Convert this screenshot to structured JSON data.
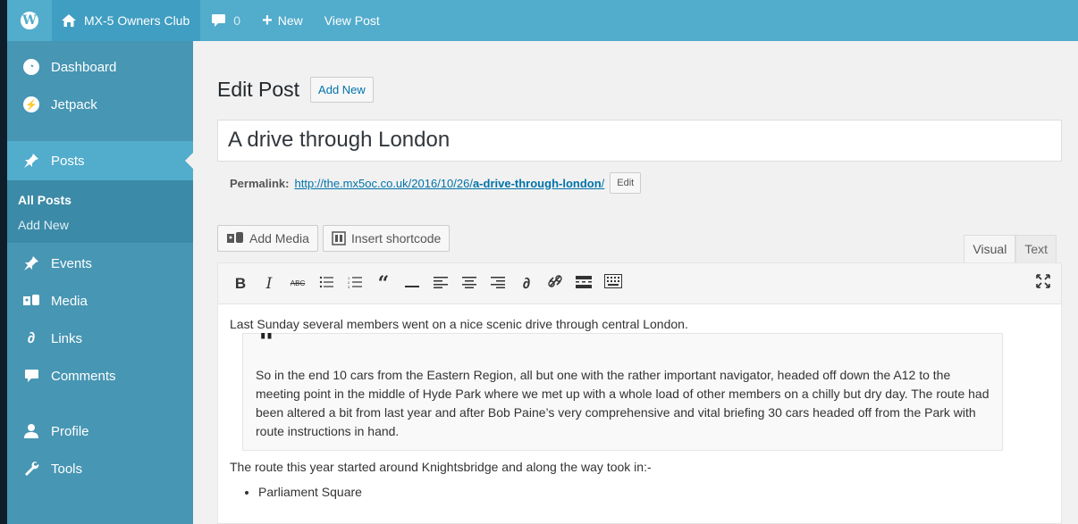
{
  "adminbar": {
    "wp_icon": "wordpress-icon",
    "site_name": "MX-5 Owners Club",
    "comments_count": "0",
    "new_label": "New",
    "view_post_label": "View Post"
  },
  "sidebar": {
    "items": [
      {
        "label": "Dashboard",
        "icon": "dashboard-icon"
      },
      {
        "label": "Jetpack",
        "icon": "jetpack-icon"
      },
      {
        "label": "Posts",
        "icon": "pin-icon"
      },
      {
        "label": "Events",
        "icon": "pin-icon"
      },
      {
        "label": "Media",
        "icon": "media-icon"
      },
      {
        "label": "Links",
        "icon": "link-icon"
      },
      {
        "label": "Comments",
        "icon": "comment-icon"
      },
      {
        "label": "Profile",
        "icon": "user-icon"
      },
      {
        "label": "Tools",
        "icon": "wrench-icon"
      }
    ],
    "submenu": [
      {
        "label": "All Posts"
      },
      {
        "label": "Add New"
      }
    ]
  },
  "page": {
    "title": "Edit Post",
    "add_new": "Add New"
  },
  "post": {
    "title": "A drive through London",
    "permalink_label": "Permalink:",
    "permalink_base": "http://the.mx5oc.co.uk/2016/10/26/",
    "permalink_slug": "a-drive-through-london",
    "permalink_end": "/",
    "edit_label": "Edit"
  },
  "editor": {
    "add_media": "Add Media",
    "insert_shortcode": "Insert shortcode",
    "tab_visual": "Visual",
    "tab_text": "Text",
    "toolbar": [
      {
        "name": "bold-icon",
        "glyph": "B"
      },
      {
        "name": "italic-icon",
        "glyph": "I"
      },
      {
        "name": "strikethrough-icon",
        "glyph": "ABC"
      },
      {
        "name": "bullet-list-icon",
        "glyph": "☰"
      },
      {
        "name": "numbered-list-icon",
        "glyph": "☷"
      },
      {
        "name": "blockquote-icon",
        "glyph": "❝"
      },
      {
        "name": "horizontal-line-icon",
        "glyph": "—"
      },
      {
        "name": "align-left-icon",
        "glyph": "☰"
      },
      {
        "name": "align-center-icon",
        "glyph": "☰"
      },
      {
        "name": "align-right-icon",
        "glyph": "☰"
      },
      {
        "name": "link-icon",
        "glyph": "🔗"
      },
      {
        "name": "unlink-icon",
        "glyph": "⛓"
      },
      {
        "name": "read-more-icon",
        "glyph": "▬"
      },
      {
        "name": "toolbar-toggle-icon",
        "glyph": "▦"
      }
    ],
    "paragraph1": "Last Sunday several members went on a nice scenic drive through central London.",
    "quote": "So in the end 10 cars from the Eastern Region, all but one with the rather important navigator, headed off down the A12 to the meeting point in the middle of Hyde Park where we met up with a whole load of other members on a chilly but dry day.  The route had been altered a bit from last year and after Bob Paine’s very comprehensive and vital briefing 30 cars headed off from the Park with route instructions in hand.",
    "paragraph2": "The route this year started around Knightsbridge and along the way took in:-",
    "list": [
      "Parliament Square"
    ]
  }
}
